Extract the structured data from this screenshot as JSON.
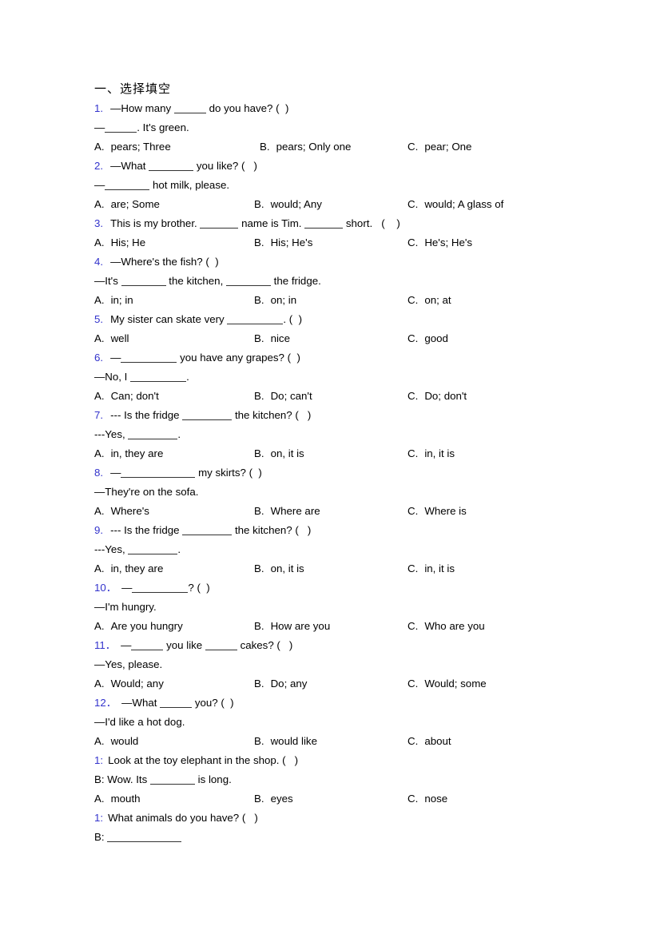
{
  "document": {
    "heading": "一、选择填空",
    "items": [
      {
        "num": "1.",
        "q_lines": [
          "—How many ＿＿＿ do you have? (  )",
          "—＿＿＿. It's green."
        ],
        "options": [
          "pears; Three",
          "pears; Only one",
          "pear; One"
        ],
        "wide_b": true
      },
      {
        "num": "2.",
        "q_lines": [
          "—What ＿＿＿＿ you like? (   )",
          "—＿＿＿＿ hot milk, please."
        ],
        "options": [
          "are; Some",
          "would; Any",
          "would; A glass of"
        ],
        "wide_b": false
      },
      {
        "num": "3.",
        "q_lines": [
          "This is my brother. ＿＿＿ name is Tim. ＿＿＿ short.   (    )"
        ],
        "options": [
          "His; He",
          "His; He's",
          "He's; He's"
        ],
        "wide_b": false
      },
      {
        "num": "4.",
        "q_lines": [
          "—Where's the fish? (  )",
          "—It's ＿＿＿＿ the kitchen, ＿＿＿＿ the fridge."
        ],
        "options": [
          "in; in",
          "on; in",
          "on; at"
        ],
        "wide_b": false
      },
      {
        "num": "5.",
        "q_lines": [
          "My sister can skate very ＿＿＿＿＿. (  )"
        ],
        "options": [
          "well",
          "nice",
          "good"
        ],
        "wide_b": false
      },
      {
        "num": "6.",
        "q_lines": [
          "—＿＿＿＿＿ you have any grapes? (  )",
          "—No, I ＿＿＿＿＿."
        ],
        "options": [
          "Can; don't",
          "Do; can't",
          "Do; don't"
        ],
        "wide_b": false
      },
      {
        "num": "7.",
        "q_lines": [
          "--- Is the fridge ＿＿＿＿ the kitchen? (   )",
          "---Yes, ＿＿＿＿."
        ],
        "options": [
          "in, they are",
          "on, it is",
          "in, it is"
        ],
        "wide_b": false
      },
      {
        "num": "8.",
        "q_lines": [
          "—＿＿＿＿＿＿ my skirts? (  )",
          "—They're on the sofa."
        ],
        "options": [
          "Where's",
          "Where are",
          "Where is"
        ],
        "wide_b": false
      },
      {
        "num": "9.",
        "q_lines": [
          "--- Is the fridge ＿＿＿＿ the kitchen? (   )",
          "---Yes, ＿＿＿＿."
        ],
        "options": [
          "in, they are",
          "on, it is",
          "in, it is"
        ],
        "wide_b": false
      },
      {
        "num": "10．",
        "q_lines": [
          "—＿＿＿＿＿? (  )",
          "—I'm hungry."
        ],
        "options": [
          "Are you hungry",
          "How are you",
          "Who are you"
        ],
        "wide_b": false
      },
      {
        "num": "11．",
        "q_lines": [
          "—＿＿＿ you like ＿＿＿ cakes? (   )",
          "—Yes, please."
        ],
        "options": [
          "Would; any",
          "Do; any",
          "Would; some"
        ],
        "wide_b": false
      },
      {
        "num": "12．",
        "q_lines": [
          "—What ＿＿＿ you? (  )",
          "—I'd like a hot dog."
        ],
        "options": [
          "would",
          "would like",
          "about"
        ],
        "wide_b": false
      },
      {
        "num": "1:",
        "q_lines": [
          "Look at the toy elephant in the shop. (   )",
          "B: Wow. Its ＿＿＿＿ is long."
        ],
        "options": [
          "mouth",
          "eyes",
          "nose"
        ],
        "wide_b": false,
        "dialogue": true
      },
      {
        "num": "1:",
        "q_lines": [
          "What animals do you have? (   )",
          "B: ＿＿＿＿＿＿＿"
        ],
        "options": [],
        "wide_b": false,
        "dialogue": true
      }
    ],
    "option_labels": [
      "A.",
      "B.",
      "C."
    ],
    "colors": {
      "number": "#3333cc",
      "text": "#000000",
      "background": "#ffffff"
    }
  }
}
